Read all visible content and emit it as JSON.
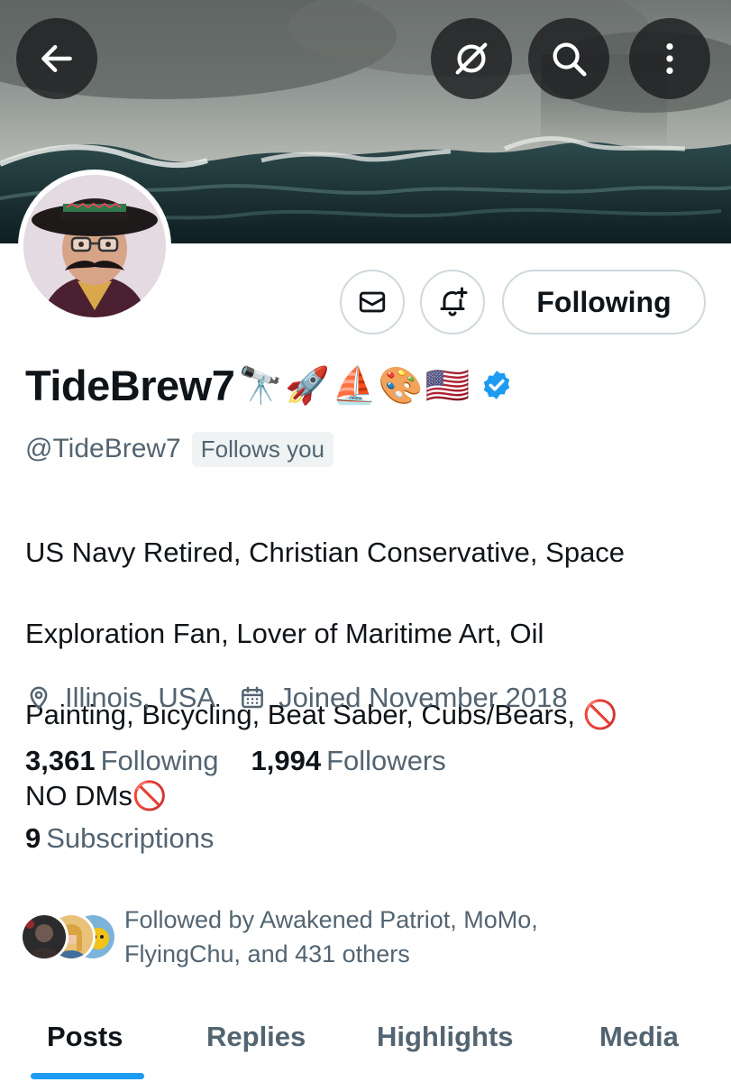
{
  "profile": {
    "display_name": "TideBrew7",
    "name_emoji": "🔭🚀⛵🎨🇺🇸",
    "handle": "@TideBrew7",
    "follows_you": "Follows you",
    "bio_line1": "US Navy Retired, Christian Conservative, Space",
    "bio_line2": "Exploration Fan, Lover of Maritime Art, Oil",
    "bio_line3": "Painting, Bicycling, Beat Saber, Cubs/Bears, ",
    "bio_line4": "NO DMs",
    "bio_no_symbol": "🚫",
    "location": "Illinois, USA",
    "joined": "Joined November 2018",
    "verified": true
  },
  "actions": {
    "following_label": "Following",
    "message_icon": "envelope-icon",
    "notify_icon": "bell-plus-icon"
  },
  "header": {
    "back_icon": "arrow-left-icon",
    "hide_icon": "eye-slash-icon",
    "search_icon": "search-icon",
    "more_icon": "kebab-icon"
  },
  "stats": {
    "following_count": "3,361",
    "following_label": "Following",
    "followers_count": "1,994",
    "followers_label": "Followers",
    "subscriptions_count": "9",
    "subscriptions_label": "Subscriptions"
  },
  "followed_by": {
    "text_line1": "Followed by Awakened Patriot, MoMo,",
    "text_line2": "FlyingChu, and 431 others"
  },
  "tabs": [
    {
      "label": "Posts",
      "active": true
    },
    {
      "label": "Replies",
      "active": false
    },
    {
      "label": "Highlights",
      "active": false
    },
    {
      "label": "Media",
      "active": false
    }
  ],
  "colors": {
    "accent": "#1d9bf0",
    "secondary_text": "#536471",
    "primary_text": "#0f1419",
    "border": "#cfd9de"
  }
}
